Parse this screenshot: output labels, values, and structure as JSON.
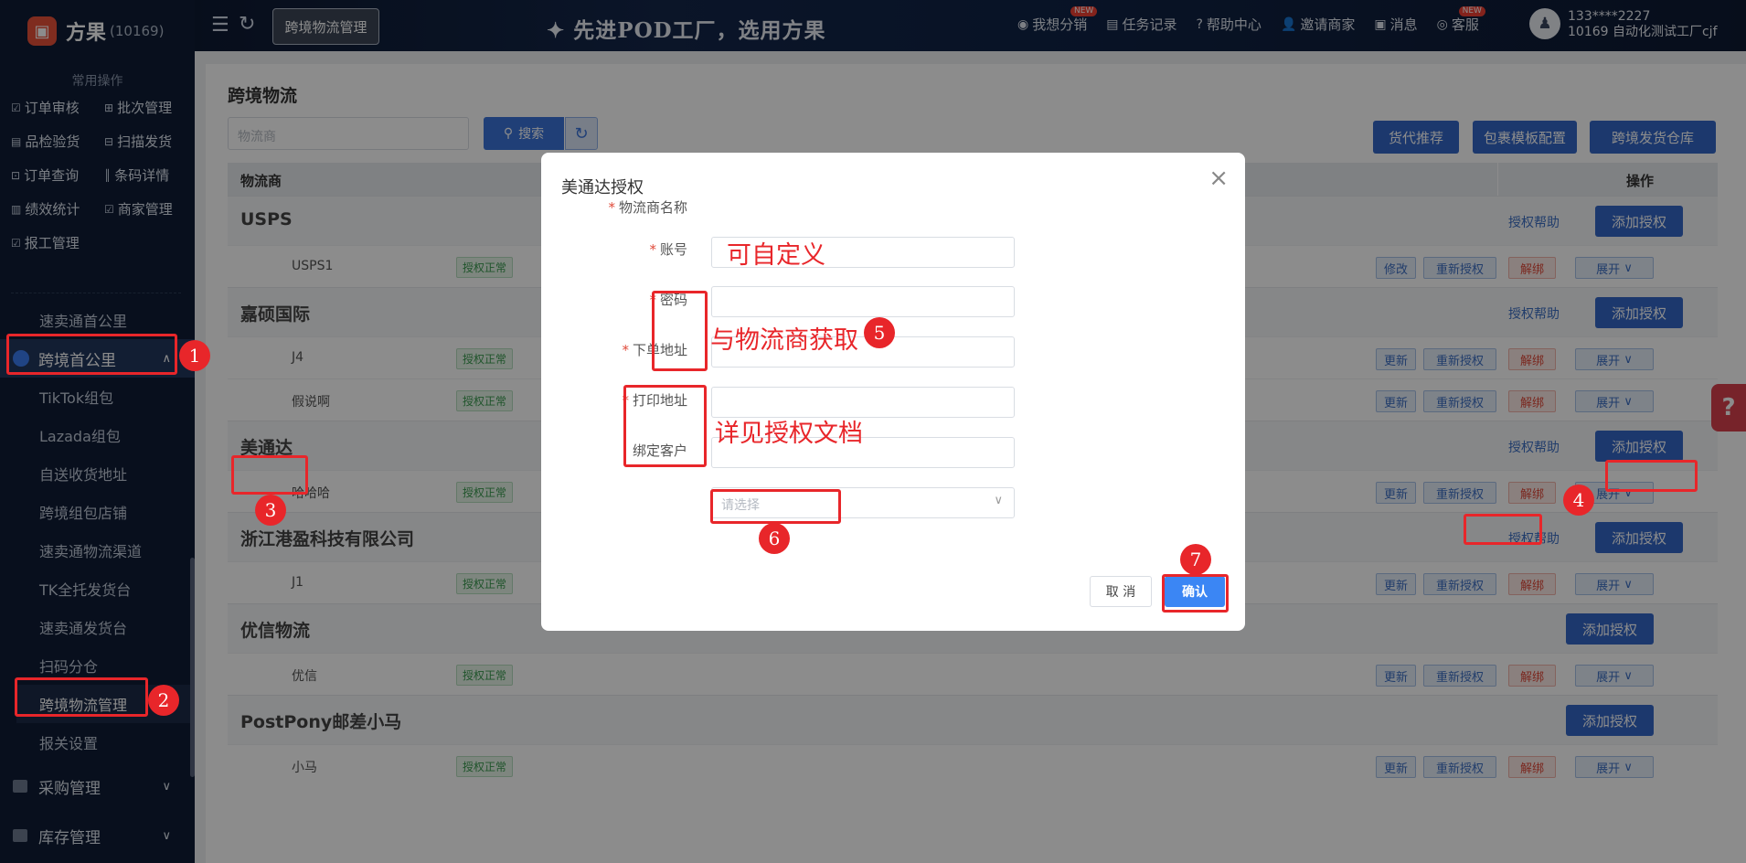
{
  "app": {
    "name": "方果",
    "id": "(10169)"
  },
  "header": {
    "tab": "跨境物流管理",
    "slogan": "✦ 先进POD工厂，选用方果",
    "nav": [
      {
        "label": "我想分销",
        "icon": "share-icon",
        "badge": "NEW"
      },
      {
        "label": "任务记录",
        "icon": "task-icon",
        "badge": ""
      },
      {
        "label": "帮助中心",
        "icon": "help-icon",
        "badge": ""
      },
      {
        "label": "邀请商家",
        "icon": "invite-icon",
        "badge": ""
      },
      {
        "label": "消息",
        "icon": "message-icon",
        "badge": ""
      },
      {
        "label": "客服",
        "icon": "service-icon",
        "badge": "NEW"
      }
    ],
    "user": {
      "phone": "133****2227",
      "org": "10169 自动化测试工厂cjf"
    }
  },
  "sidebar": {
    "quick_title": "常用操作",
    "quick": [
      "订单审核",
      "批次管理",
      "品检验货",
      "扫描发货",
      "订单查询",
      "条码详情",
      "绩效统计",
      "商家管理",
      "报工管理"
    ],
    "menu": {
      "above": "速卖通首公里",
      "group": "跨境首公里",
      "items": [
        "TikTok组包",
        "Lazada组包",
        "自送收货地址",
        "跨境组包店铺",
        "速卖通物流渠道",
        "TK全托发货台",
        "速卖通发货台",
        "扫码分仓",
        "跨境物流管理",
        "报关设置"
      ],
      "groups_below": [
        "采购管理",
        "库存管理"
      ]
    }
  },
  "page": {
    "title": "跨境物流",
    "carrier_placeholder": "物流商",
    "search_label": "搜索",
    "top_buttons": [
      "货代推荐",
      "包裹模板配置",
      "跨境发货仓库"
    ],
    "col_carrier": "物流商",
    "col_action": "操作",
    "help_label": "授权帮助",
    "add_label": "添加授权",
    "status_ok": "授权正常",
    "actions": {
      "edit": "修改",
      "update": "更新",
      "reauth": "重新授权",
      "unbind": "解绑",
      "expand": "展开"
    },
    "groups": [
      {
        "name": "USPS",
        "help": true,
        "subs": [
          {
            "name": "USPS1",
            "first": "修改"
          }
        ]
      },
      {
        "name": "嘉硕国际",
        "help": true,
        "subs": [
          {
            "name": "J4",
            "first": "更新"
          },
          {
            "name": "假说啊",
            "first": "更新"
          }
        ]
      },
      {
        "name": "美通达",
        "help": true,
        "subs": [
          {
            "name": "哈哈哈",
            "first": "更新"
          }
        ]
      },
      {
        "name": "浙江港盈科技有限公司",
        "help": true,
        "subs": [
          {
            "name": "J1",
            "first": "更新"
          }
        ]
      },
      {
        "name": "优信物流",
        "help": false,
        "subs": [
          {
            "name": "优信",
            "first": "更新"
          }
        ]
      },
      {
        "name": "PostPony邮差小马",
        "help": false,
        "subs": [
          {
            "name": "小马",
            "first": "更新"
          }
        ]
      }
    ]
  },
  "modal": {
    "title": "美通达授权",
    "fields": [
      {
        "label": "物流商名称",
        "required": true,
        "value": "",
        "placeholder": ""
      },
      {
        "label": "账号",
        "required": true,
        "value": "",
        "placeholder": ""
      },
      {
        "label": "密码",
        "required": true,
        "value": "",
        "placeholder": ""
      },
      {
        "label": "下单地址",
        "required": true,
        "value": "",
        "placeholder": ""
      },
      {
        "label": "打印地址",
        "required": true,
        "value": "",
        "placeholder": ""
      },
      {
        "label": "绑定客户",
        "required": false,
        "value": "",
        "placeholder": "请选择"
      }
    ],
    "cancel": "取 消",
    "confirm": "确认"
  },
  "annotations": {
    "notes": [
      "可自定义",
      "与物流商获取",
      "详见授权文档"
    ],
    "numbers": [
      "1",
      "2",
      "3",
      "4",
      "5",
      "6",
      "7"
    ],
    "color": "#e8262a"
  },
  "help_float": "?"
}
